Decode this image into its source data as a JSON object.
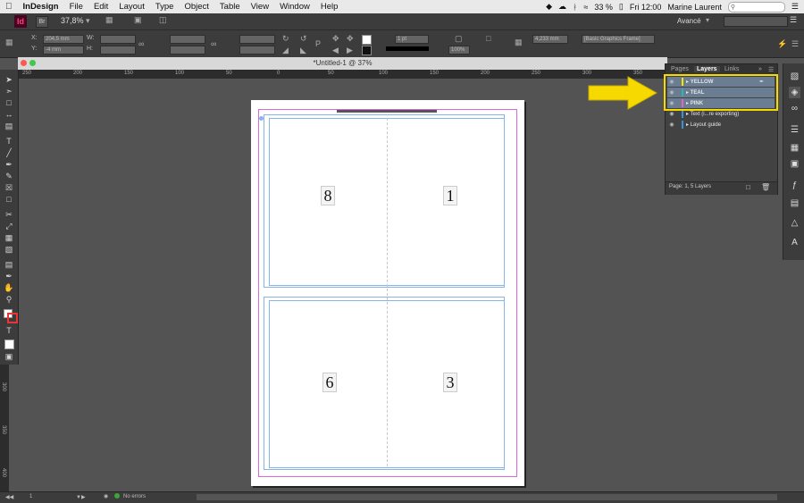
{
  "menubar": {
    "apple": "",
    "app": "InDesign",
    "items": [
      "File",
      "Edit",
      "Layout",
      "Type",
      "Object",
      "Table",
      "View",
      "Window",
      "Help"
    ],
    "battery": "33 %",
    "clock": "Fri 12:00",
    "user": "Marine Laurent"
  },
  "appbar": {
    "logo": "Id",
    "br": "Br",
    "zoom": "37,8%",
    "workspace": "Avancé"
  },
  "controlbar": {
    "x_label": "X:",
    "x_value": "204,5 mm",
    "y_label": "Y:",
    "y_value": "-4 mm",
    "w_label": "W:",
    "h_label": "H:",
    "stroke_weight": "1 pt",
    "opacity": "100%",
    "dimension": "4,233 mm",
    "style": "[Basic Graphics Frame]"
  },
  "document": {
    "title": "*Untitled-1 @ 37%",
    "page_numbers": [
      "8",
      "1",
      "6",
      "3"
    ]
  },
  "rulers": {
    "h_ticks": [
      "250",
      "200",
      "150",
      "100",
      "50",
      "0",
      "50",
      "100",
      "150",
      "200",
      "250",
      "300",
      "350"
    ],
    "v_ticks": [
      "300",
      "350",
      "400"
    ]
  },
  "layers_panel": {
    "tabs": [
      "Pages",
      "Layers",
      "Links"
    ],
    "layers": [
      {
        "name": "YELLOW",
        "color": "#f5e600"
      },
      {
        "name": "TEAL",
        "color": "#2cb5b0"
      },
      {
        "name": "PINK",
        "color": "#e860c0"
      },
      {
        "name": "Text (i...re exporting)",
        "color": "#3b8fe0"
      },
      {
        "name": "Layout guide",
        "color": "#3b8fe0"
      }
    ],
    "footer": "Page: 1, 5 Layers"
  },
  "status": {
    "page": "1",
    "errors": "No errors"
  },
  "colors": {
    "highlight": "#f5d900",
    "arrow": "#f5d900",
    "selected_row": "#6a7d92"
  }
}
